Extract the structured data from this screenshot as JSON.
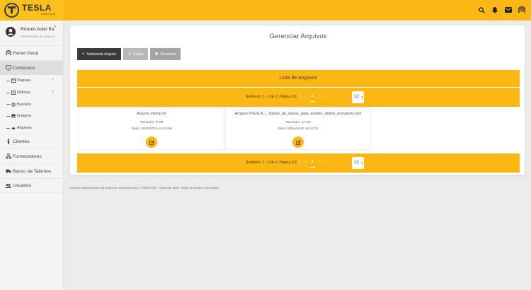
{
  "brand": {
    "name": "TESLA",
    "sub": "ENERGIA"
  },
  "topbar": {
    "icons": [
      "search-icon",
      "bell-icon",
      "mail-icon",
      "broadcast-icon"
    ]
  },
  "user": {
    "name": "Ricardo Auler Ba",
    "role": "Administrador do Sistema"
  },
  "sidebar": {
    "items": [
      {
        "label": "Painel Geral",
        "icon": "broadcast-icon"
      },
      {
        "label": "Conteúdos",
        "icon": "monitor-icon"
      },
      {
        "label": "Clientes",
        "icon": "person-icon"
      },
      {
        "label": "Fornecedores",
        "icon": "sitemap-icon"
      },
      {
        "label": "Banco de Talentos",
        "icon": "truck-icon"
      },
      {
        "label": "Usuários",
        "icon": "users-icon"
      }
    ],
    "subitems": [
      {
        "label": "Páginas",
        "icon": "window-icon",
        "caret": "˅"
      },
      {
        "label": "Notícias",
        "icon": "newspaper-icon",
        "caret": "˅"
      },
      {
        "label": "Banners",
        "icon": "gear-icon"
      },
      {
        "label": "Imagens",
        "icon": "image-icon"
      },
      {
        "label": "Arquivos",
        "icon": "cloud-icon"
      }
    ]
  },
  "main": {
    "title": "Gerenciar Arquivos",
    "buttons": {
      "select": "Selecionar Arquivo",
      "send": "Enviar",
      "manage": "Gerenciar"
    },
    "list_title": "Lista de Arquivos",
    "pager": {
      "text": "(Exibindo: 1 - 2 de 2. Página 1/1)",
      "current_page": "1",
      "page_size": "12"
    },
    "files": [
      {
        "name": "Arquivo #temp.txt",
        "size": "Tamanho: 0 KB",
        "date": "Data: 14/03/2016 13:43:59"
      },
      {
        "name": "Arquivo #TESLA_-_Tabela_de_dados_para_analise_dados_prospects.xlsx",
        "size": "Tamanho: 12 KB",
        "date": "Data: 03/04/2020 19:32:12"
      }
    ]
  },
  "footer": "Sistema Administrativo da Empresa Tesla Energia | ©ITERATOR - Sistemas Web. Todos os direitos reservados.",
  "colors": {
    "accent": "#fbb814",
    "dark_button": "#3a3a3a"
  }
}
